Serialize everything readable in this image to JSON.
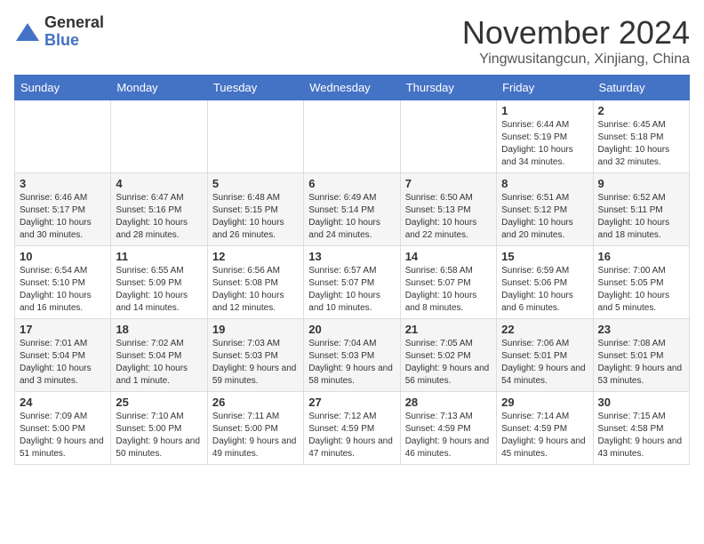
{
  "header": {
    "logo_general": "General",
    "logo_blue": "Blue",
    "month_title": "November 2024",
    "location": "Yingwusitangcun, Xinjiang, China"
  },
  "weekdays": [
    "Sunday",
    "Monday",
    "Tuesday",
    "Wednesday",
    "Thursday",
    "Friday",
    "Saturday"
  ],
  "weeks": [
    [
      {
        "day": "",
        "info": ""
      },
      {
        "day": "",
        "info": ""
      },
      {
        "day": "",
        "info": ""
      },
      {
        "day": "",
        "info": ""
      },
      {
        "day": "",
        "info": ""
      },
      {
        "day": "1",
        "info": "Sunrise: 6:44 AM\nSunset: 5:19 PM\nDaylight: 10 hours and 34 minutes."
      },
      {
        "day": "2",
        "info": "Sunrise: 6:45 AM\nSunset: 5:18 PM\nDaylight: 10 hours and 32 minutes."
      }
    ],
    [
      {
        "day": "3",
        "info": "Sunrise: 6:46 AM\nSunset: 5:17 PM\nDaylight: 10 hours and 30 minutes."
      },
      {
        "day": "4",
        "info": "Sunrise: 6:47 AM\nSunset: 5:16 PM\nDaylight: 10 hours and 28 minutes."
      },
      {
        "day": "5",
        "info": "Sunrise: 6:48 AM\nSunset: 5:15 PM\nDaylight: 10 hours and 26 minutes."
      },
      {
        "day": "6",
        "info": "Sunrise: 6:49 AM\nSunset: 5:14 PM\nDaylight: 10 hours and 24 minutes."
      },
      {
        "day": "7",
        "info": "Sunrise: 6:50 AM\nSunset: 5:13 PM\nDaylight: 10 hours and 22 minutes."
      },
      {
        "day": "8",
        "info": "Sunrise: 6:51 AM\nSunset: 5:12 PM\nDaylight: 10 hours and 20 minutes."
      },
      {
        "day": "9",
        "info": "Sunrise: 6:52 AM\nSunset: 5:11 PM\nDaylight: 10 hours and 18 minutes."
      }
    ],
    [
      {
        "day": "10",
        "info": "Sunrise: 6:54 AM\nSunset: 5:10 PM\nDaylight: 10 hours and 16 minutes."
      },
      {
        "day": "11",
        "info": "Sunrise: 6:55 AM\nSunset: 5:09 PM\nDaylight: 10 hours and 14 minutes."
      },
      {
        "day": "12",
        "info": "Sunrise: 6:56 AM\nSunset: 5:08 PM\nDaylight: 10 hours and 12 minutes."
      },
      {
        "day": "13",
        "info": "Sunrise: 6:57 AM\nSunset: 5:07 PM\nDaylight: 10 hours and 10 minutes."
      },
      {
        "day": "14",
        "info": "Sunrise: 6:58 AM\nSunset: 5:07 PM\nDaylight: 10 hours and 8 minutes."
      },
      {
        "day": "15",
        "info": "Sunrise: 6:59 AM\nSunset: 5:06 PM\nDaylight: 10 hours and 6 minutes."
      },
      {
        "day": "16",
        "info": "Sunrise: 7:00 AM\nSunset: 5:05 PM\nDaylight: 10 hours and 5 minutes."
      }
    ],
    [
      {
        "day": "17",
        "info": "Sunrise: 7:01 AM\nSunset: 5:04 PM\nDaylight: 10 hours and 3 minutes."
      },
      {
        "day": "18",
        "info": "Sunrise: 7:02 AM\nSunset: 5:04 PM\nDaylight: 10 hours and 1 minute."
      },
      {
        "day": "19",
        "info": "Sunrise: 7:03 AM\nSunset: 5:03 PM\nDaylight: 9 hours and 59 minutes."
      },
      {
        "day": "20",
        "info": "Sunrise: 7:04 AM\nSunset: 5:03 PM\nDaylight: 9 hours and 58 minutes."
      },
      {
        "day": "21",
        "info": "Sunrise: 7:05 AM\nSunset: 5:02 PM\nDaylight: 9 hours and 56 minutes."
      },
      {
        "day": "22",
        "info": "Sunrise: 7:06 AM\nSunset: 5:01 PM\nDaylight: 9 hours and 54 minutes."
      },
      {
        "day": "23",
        "info": "Sunrise: 7:08 AM\nSunset: 5:01 PM\nDaylight: 9 hours and 53 minutes."
      }
    ],
    [
      {
        "day": "24",
        "info": "Sunrise: 7:09 AM\nSunset: 5:00 PM\nDaylight: 9 hours and 51 minutes."
      },
      {
        "day": "25",
        "info": "Sunrise: 7:10 AM\nSunset: 5:00 PM\nDaylight: 9 hours and 50 minutes."
      },
      {
        "day": "26",
        "info": "Sunrise: 7:11 AM\nSunset: 5:00 PM\nDaylight: 9 hours and 49 minutes."
      },
      {
        "day": "27",
        "info": "Sunrise: 7:12 AM\nSunset: 4:59 PM\nDaylight: 9 hours and 47 minutes."
      },
      {
        "day": "28",
        "info": "Sunrise: 7:13 AM\nSunset: 4:59 PM\nDaylight: 9 hours and 46 minutes."
      },
      {
        "day": "29",
        "info": "Sunrise: 7:14 AM\nSunset: 4:59 PM\nDaylight: 9 hours and 45 minutes."
      },
      {
        "day": "30",
        "info": "Sunrise: 7:15 AM\nSunset: 4:58 PM\nDaylight: 9 hours and 43 minutes."
      }
    ]
  ]
}
